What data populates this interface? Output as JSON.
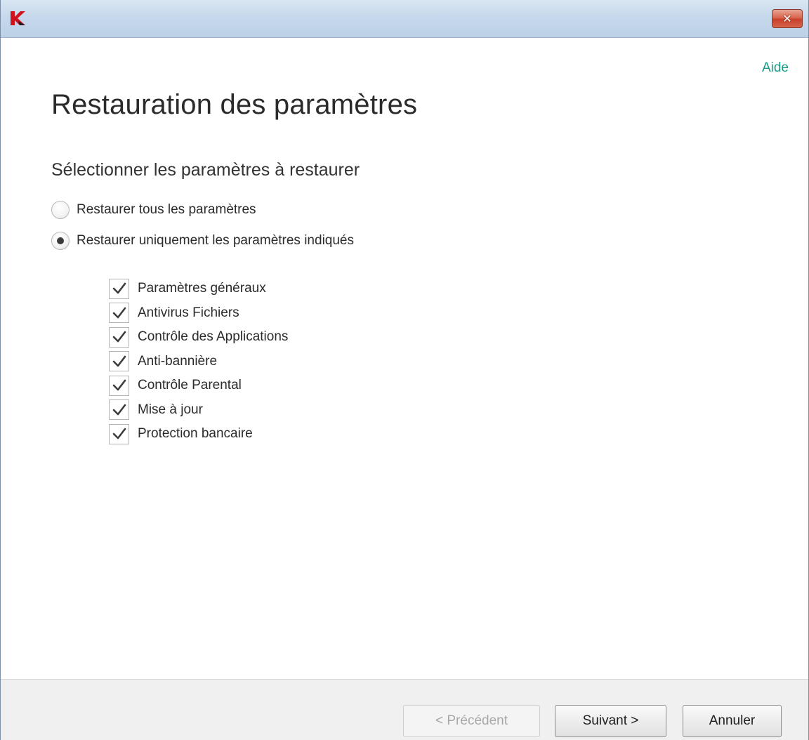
{
  "titlebar": {
    "app_icon": "kaspersky-logo-icon",
    "close_icon": "close-icon",
    "close_label": "✕"
  },
  "help_link": "Aide",
  "page_title": "Restauration des paramètres",
  "section_subtitle": "Sélectionner les paramètres à restaurer",
  "options": [
    {
      "label": "Restaurer tous les paramètres",
      "selected": false
    },
    {
      "label": "Restaurer uniquement les paramètres indiqués",
      "selected": true
    }
  ],
  "settings": [
    {
      "label": "Paramètres généraux",
      "checked": true
    },
    {
      "label": "Antivirus Fichiers",
      "checked": true
    },
    {
      "label": "Contrôle des Applications",
      "checked": true
    },
    {
      "label": "Anti-bannière",
      "checked": true
    },
    {
      "label": "Contrôle Parental",
      "checked": true
    },
    {
      "label": "Mise à jour",
      "checked": true
    },
    {
      "label": "Protection bancaire",
      "checked": true
    }
  ],
  "buttons": {
    "previous": "< Précédent",
    "next": "Suivant >",
    "cancel": "Annuler"
  },
  "colors": {
    "help_link": "#1a9a85",
    "logo_red": "#d0121f",
    "close_button": "#c7402a"
  }
}
